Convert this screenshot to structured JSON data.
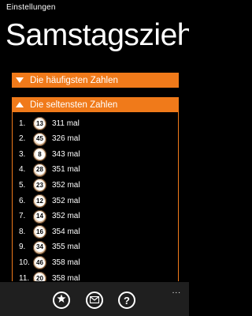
{
  "header": {
    "app_title": "Einstellungen",
    "page_title": "Samstagsziehung"
  },
  "sections": [
    {
      "label": "Die häufigsten Zahlen",
      "expanded": false
    },
    {
      "label": "Die seltensten Zahlen",
      "expanded": true
    }
  ],
  "rows": [
    {
      "rank": "1.",
      "number": "13",
      "count": "311 mal"
    },
    {
      "rank": "2.",
      "number": "45",
      "count": "326 mal"
    },
    {
      "rank": "3.",
      "number": "8",
      "count": "343 mal"
    },
    {
      "rank": "4.",
      "number": "28",
      "count": "351 mal"
    },
    {
      "rank": "5.",
      "number": "23",
      "count": "352 mal"
    },
    {
      "rank": "6.",
      "number": "12",
      "count": "352 mal"
    },
    {
      "rank": "7.",
      "number": "14",
      "count": "352 mal"
    },
    {
      "rank": "8.",
      "number": "16",
      "count": "354 mal"
    },
    {
      "rank": "9.",
      "number": "34",
      "count": "355 mal"
    },
    {
      "rank": "10.",
      "number": "46",
      "count": "358 mal"
    },
    {
      "rank": "11.",
      "number": "20",
      "count": "358 mal"
    }
  ],
  "app_bar": {
    "buttons": [
      {
        "icon": "star-plus-icon"
      },
      {
        "icon": "mail-icon"
      },
      {
        "icon": "help-icon",
        "glyph": "?"
      }
    ],
    "more": "..."
  },
  "colors": {
    "accent": "#f07a1a",
    "background": "#000000",
    "app_bar": "#1f1f1f"
  }
}
